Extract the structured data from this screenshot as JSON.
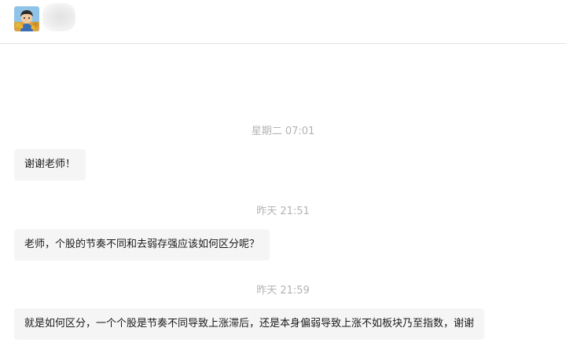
{
  "header": {
    "avatar_icon": "user-avatar-photo",
    "contact_name_redacted": true
  },
  "messages": [
    {
      "timestamp": "星期二 07:01",
      "text": "谢谢老师！"
    },
    {
      "timestamp": "昨天 21:51",
      "text": "老师，个股的节奏不同和去弱存强应该如何区分呢？"
    },
    {
      "timestamp": "昨天 21:59",
      "text": "就是如何区分，一个个股是节奏不同导致上涨滞后，还是本身偏弱导致上涨不如板块乃至指数，谢谢"
    }
  ],
  "colors": {
    "bubble_bg": "#f5f5f5",
    "timestamp": "#b3b3b3",
    "divider": "#e4e4e4"
  }
}
